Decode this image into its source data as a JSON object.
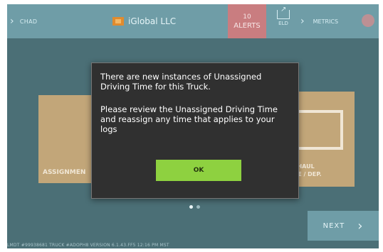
{
  "header": {
    "driver": "CHAD",
    "company": "iGlobal LLC",
    "alerts_count": "10",
    "alerts_label": "ALERTS",
    "eld_label": "ELD",
    "metrics_label": "METRICS"
  },
  "background_tiles": {
    "left_label": "ASSIGNMEN",
    "right_line1": "EHAUL",
    "right_line2": "VE / DEP."
  },
  "modal": {
    "message_line1": "There are new instances of Unassigned Driving Time for this Truck.",
    "message_line2": "Please review the Unassigned Driving Time and reassign any time that applies to your logs",
    "ok_label": "OK"
  },
  "pager": {
    "pages": 2,
    "active": 1
  },
  "next_label": "NEXT",
  "footer_text": "LMDT #99938681    TRUCK #ADOPH8    VERSION 6.1.43.FF5    12:16 PM MST",
  "icons": {
    "left_chevron": "chevron-right-icon",
    "company_logo": "company-logo",
    "eld": "share-icon",
    "metrics_chevron": "chevron-right-icon",
    "power": "power-icon",
    "next_chevron": "chevron-right-icon"
  }
}
